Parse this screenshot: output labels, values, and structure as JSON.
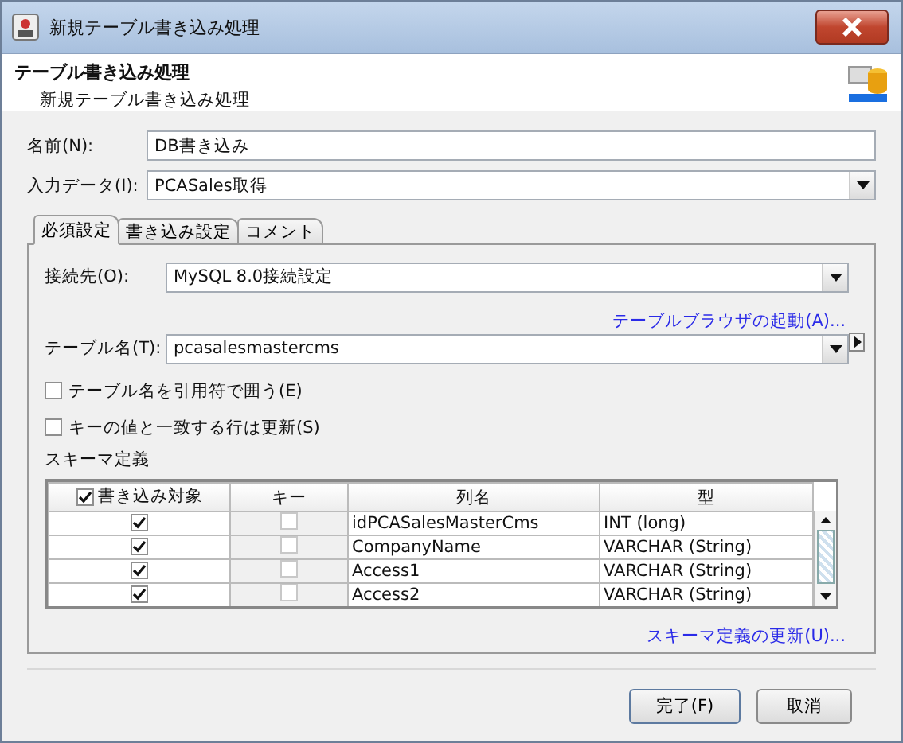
{
  "window": {
    "title": "新規テーブル書き込み処理"
  },
  "header": {
    "title": "テーブル書き込み処理",
    "subtitle": "新規テーブル書き込み処理"
  },
  "fields": [
    {
      "label": "名前(N):",
      "value": "DB書き込み",
      "kind": "text"
    },
    {
      "label": "入力データ(I):",
      "value": "PCASales取得",
      "kind": "dropdown"
    }
  ],
  "tabs": [
    {
      "label": "必須設定",
      "selected": true
    },
    {
      "label": "書き込み設定",
      "selected": false
    },
    {
      "label": "コメント",
      "selected": false
    }
  ],
  "connection": {
    "label": "接続先(O):",
    "value": "MySQL 8.0接続設定"
  },
  "browse_link": "テーブルブラウザの起動(A)...",
  "table_name": {
    "label": "テーブル名(T):",
    "value": "pcasalesmastercms"
  },
  "options": [
    {
      "label": "テーブル名を引用符で囲う(E)",
      "checked": false
    },
    {
      "label": "キーの値と一致する行は更新(S)",
      "checked": false
    }
  ],
  "schema": {
    "title": "スキーマ定義",
    "columns": [
      {
        "label": "書き込み対象",
        "checked": true
      },
      {
        "label": "キー"
      },
      {
        "label": "列名"
      },
      {
        "label": "型"
      }
    ],
    "rows": [
      {
        "write": true,
        "key": false,
        "name": "idPCASalesMasterCms",
        "type": "INT (long)"
      },
      {
        "write": true,
        "key": false,
        "name": "CompanyName",
        "type": "VARCHAR (String)"
      },
      {
        "write": true,
        "key": false,
        "name": "Access1",
        "type": "VARCHAR (String)"
      },
      {
        "write": true,
        "key": false,
        "name": "Access2",
        "type": "VARCHAR (String)"
      }
    ]
  },
  "update_link": "スキーマ定義の更新(U)...",
  "buttons": [
    "完了(F)",
    "取消"
  ]
}
